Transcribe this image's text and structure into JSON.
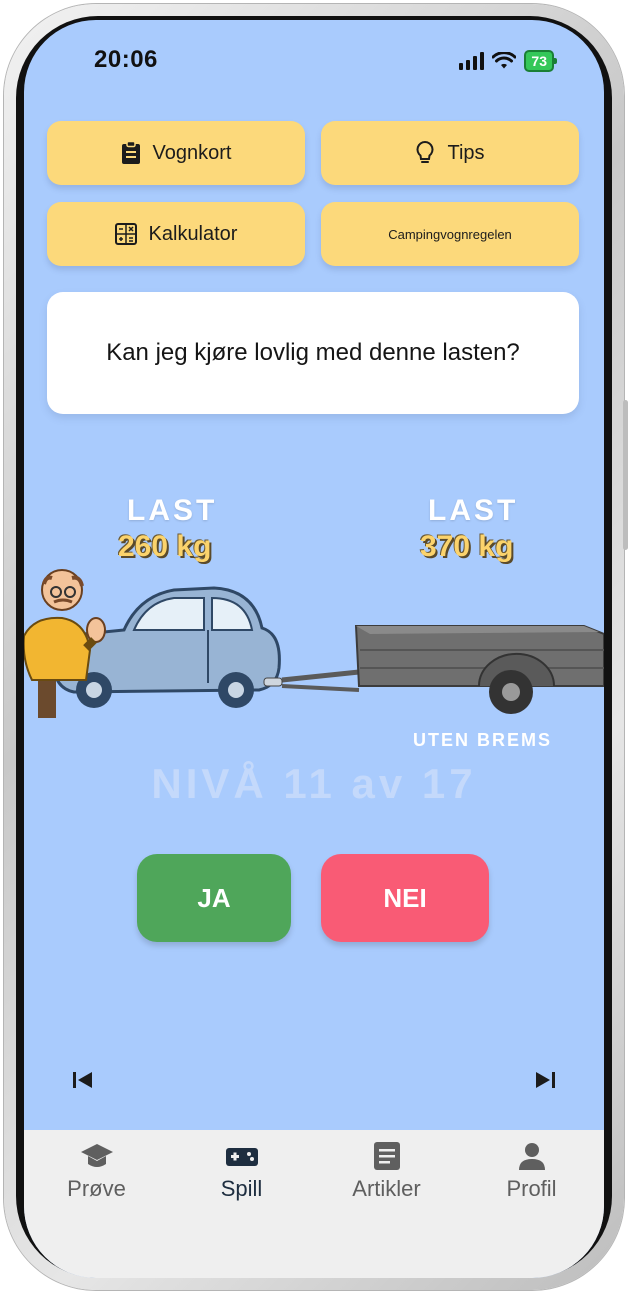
{
  "status": {
    "time": "20:06",
    "battery": "73"
  },
  "buttons": {
    "vognkort": {
      "label": "Vognkort",
      "icon": "clipboard-icon"
    },
    "tips": {
      "label": "Tips",
      "icon": "lightbulb-icon"
    },
    "kalkulator": {
      "label": "Kalkulator",
      "icon": "calculator-icon"
    },
    "camping": {
      "label": "Campingvognregelen"
    }
  },
  "question": "Kan jeg kjøre lovlig med denne lasten?",
  "car": {
    "label": "LAST",
    "value": "260 kg"
  },
  "trailer": {
    "label": "LAST",
    "value": "370 kg",
    "note": "UTEN BREMS"
  },
  "level": "NIVÅ 11 av 17",
  "answers": {
    "yes": "JA",
    "no": "NEI"
  },
  "colors": {
    "background": "#a9cbfd",
    "yellow": "#fcd97b",
    "yes": "#4fa65a",
    "no": "#f95b75"
  },
  "tabs": [
    {
      "label": "Prøve",
      "icon": "graduation-cap-icon"
    },
    {
      "label": "Spill",
      "icon": "gamepad-icon"
    },
    {
      "label": "Artikler",
      "icon": "article-icon"
    },
    {
      "label": "Profil",
      "icon": "person-icon"
    }
  ]
}
